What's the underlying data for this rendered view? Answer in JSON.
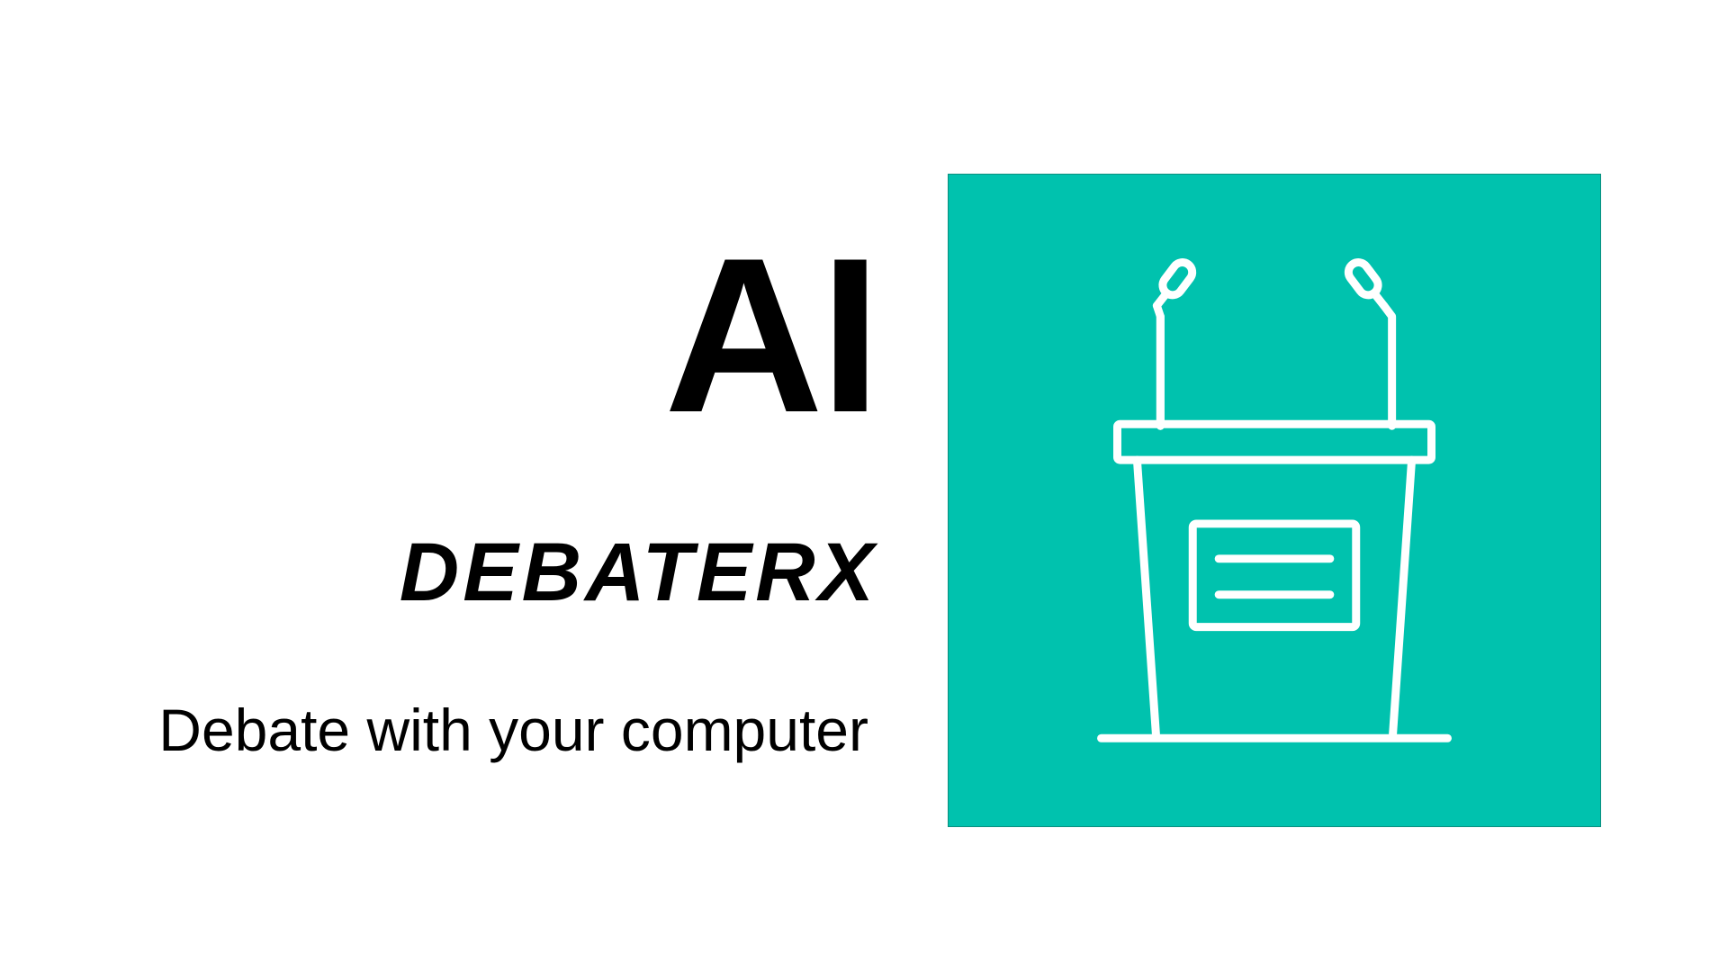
{
  "hero": {
    "title": "AI",
    "subtitle": "DEBATERX",
    "tagline": "Debate with your computer"
  },
  "icon": {
    "name": "podium-icon",
    "background_color": "#00c2ae",
    "line_color": "#ffffff"
  }
}
